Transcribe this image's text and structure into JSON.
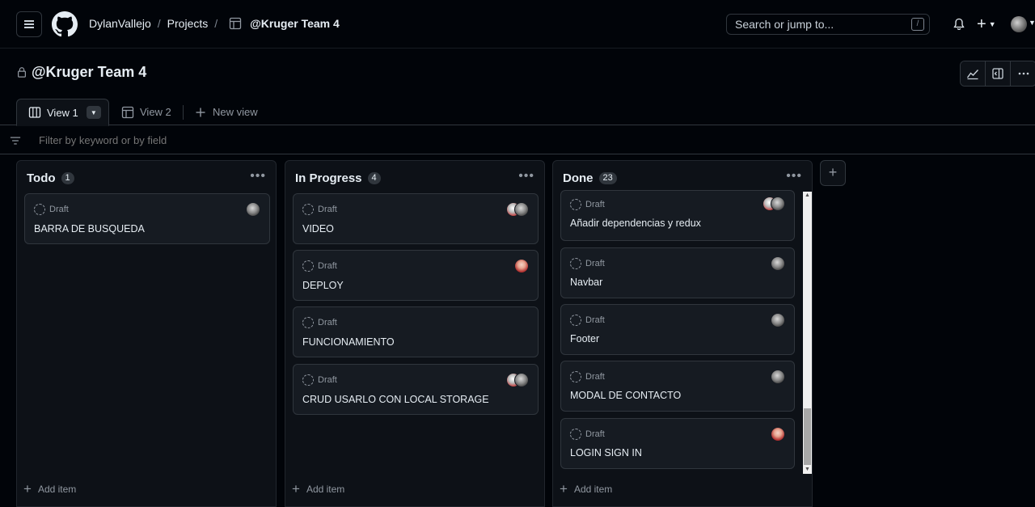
{
  "header": {
    "owner": "DylanVallejo",
    "sep1": "/",
    "projects": "Projects",
    "sep2": "/",
    "project": "@Kruger Team 4",
    "search_placeholder": "Search or jump to...",
    "search_kbd": "/"
  },
  "project": {
    "title": "@Kruger Team 4"
  },
  "tabs": [
    {
      "label": "View 1",
      "active": true
    },
    {
      "label": "View 2",
      "active": false
    },
    {
      "label": "New view",
      "active": false
    }
  ],
  "filter": {
    "placeholder": "Filter by keyword or by field"
  },
  "columns": [
    {
      "name": "Todo",
      "count": "1",
      "cards": [
        {
          "status": "Draft",
          "title": "BARRA DE BUSQUEDA",
          "avatars": [
            "gray"
          ]
        }
      ],
      "add_label": "Add item"
    },
    {
      "name": "In Progress",
      "count": "4",
      "cards": [
        {
          "status": "Draft",
          "title": "VIDEO",
          "avatars": [
            "mix",
            "gray"
          ]
        },
        {
          "status": "Draft",
          "title": "DEPLOY",
          "avatars": [
            "red"
          ]
        },
        {
          "status": "Draft",
          "title": "FUNCIONAMIENTO",
          "avatars": []
        },
        {
          "status": "Draft",
          "title": "CRUD USARLO CON LOCAL STORAGE",
          "avatars": [
            "mix",
            "gray"
          ]
        }
      ],
      "add_label": "Add item"
    },
    {
      "name": "Done",
      "count": "23",
      "cards": [
        {
          "status": "Draft",
          "title": "Añadir dependencias y redux",
          "avatars": [
            "mix",
            "gray"
          ]
        },
        {
          "status": "Draft",
          "title": "Navbar",
          "avatars": [
            "gray"
          ]
        },
        {
          "status": "Draft",
          "title": "Footer",
          "avatars": [
            "gray"
          ]
        },
        {
          "status": "Draft",
          "title": "MODAL DE CONTACTO",
          "avatars": [
            "gray"
          ]
        },
        {
          "status": "Draft",
          "title": "LOGIN SIGN IN",
          "avatars": [
            "red"
          ]
        }
      ],
      "add_label": "Add item"
    }
  ],
  "colors": {
    "background": "#010409",
    "column": "#0d1117",
    "card": "#161b22",
    "border": "#30363d",
    "muted": "#9198a1"
  },
  "icons": [
    "menu-icon",
    "github-logo-icon",
    "table-icon",
    "bell-icon",
    "plus-icon",
    "lock-icon",
    "insights-icon",
    "panel-icon",
    "kebab-icon",
    "board-icon",
    "filter-icon",
    "draft-icon"
  ]
}
